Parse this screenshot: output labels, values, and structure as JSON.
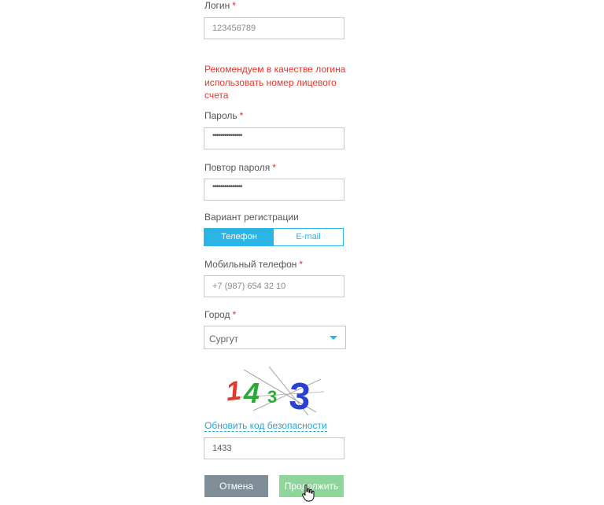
{
  "login": {
    "label": "Логин",
    "required_mark": "*",
    "value": "123456789"
  },
  "hint": "Рекомендуем в качестве логина использовать номер лицевого счета",
  "password": {
    "label": "Пароль",
    "required_mark": "*",
    "masked_value": "•••••••••••••••"
  },
  "password_repeat": {
    "label": "Повтор пароля",
    "required_mark": "*",
    "masked_value": "•••••••••••••••"
  },
  "registration_variant": {
    "label": "Вариант регистрации",
    "options": [
      "Телефон",
      "E-mail"
    ],
    "selected": "Телефон"
  },
  "mobile": {
    "label": "Мобильный телефон",
    "required_mark": "*",
    "value": "+7 (987) 654 32 10"
  },
  "city": {
    "label": "Город",
    "required_mark": "*",
    "value": "Сургут"
  },
  "captcha": {
    "image_text": "1433",
    "refresh_label": "Обновить код безопасности",
    "input_value": "1433"
  },
  "buttons": {
    "cancel": "Отмена",
    "continue": "Продолжить"
  },
  "colors": {
    "accent": "#2bb5e5",
    "required": "#d33333",
    "hint": "#e8342b",
    "cancel_button": "#7f8d96",
    "continue_button": "#8fd49a"
  }
}
